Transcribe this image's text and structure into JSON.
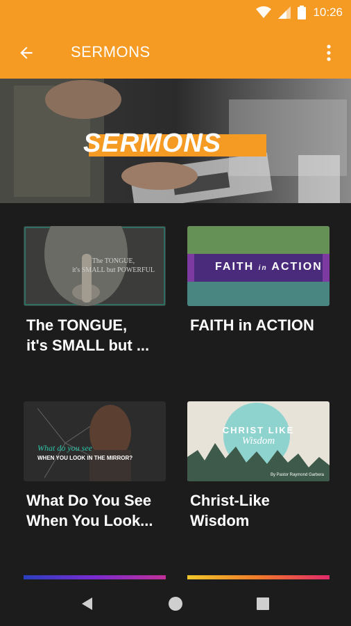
{
  "status_bar": {
    "time": "10:26",
    "icons": [
      "wifi-icon",
      "signal-icon",
      "battery-icon"
    ]
  },
  "app_bar": {
    "title": "SERMONS",
    "back_icon": "arrow-back-icon",
    "menu_icon": "more-vert-icon"
  },
  "hero": {
    "title": "SERMONS"
  },
  "sermons": [
    {
      "title": "The TONGUE,\nit's SMALL but ...",
      "thumb_text": [
        "The TONGUE,",
        "it's SMALL but POWERFUL"
      ]
    },
    {
      "title": "FAITH in ACTION",
      "thumb_text": [
        "FAITH",
        "in",
        "ACTION"
      ]
    },
    {
      "title": "What Do You See\nWhen You Look...",
      "thumb_text": [
        "What do you see",
        "WHEN YOU LOOK IN THE MIRROR?"
      ]
    },
    {
      "title": "Christ-Like\nWisdom",
      "thumb_text": [
        "CHRIST LIKE",
        "Wisdom",
        "By Pastor Raymond Garbera"
      ]
    }
  ],
  "nav_bar": {
    "icons": [
      "back-triangle-icon",
      "home-circle-icon",
      "recents-square-icon"
    ]
  },
  "colors": {
    "accent": "#f59a23",
    "background": "#1c1c1c"
  }
}
